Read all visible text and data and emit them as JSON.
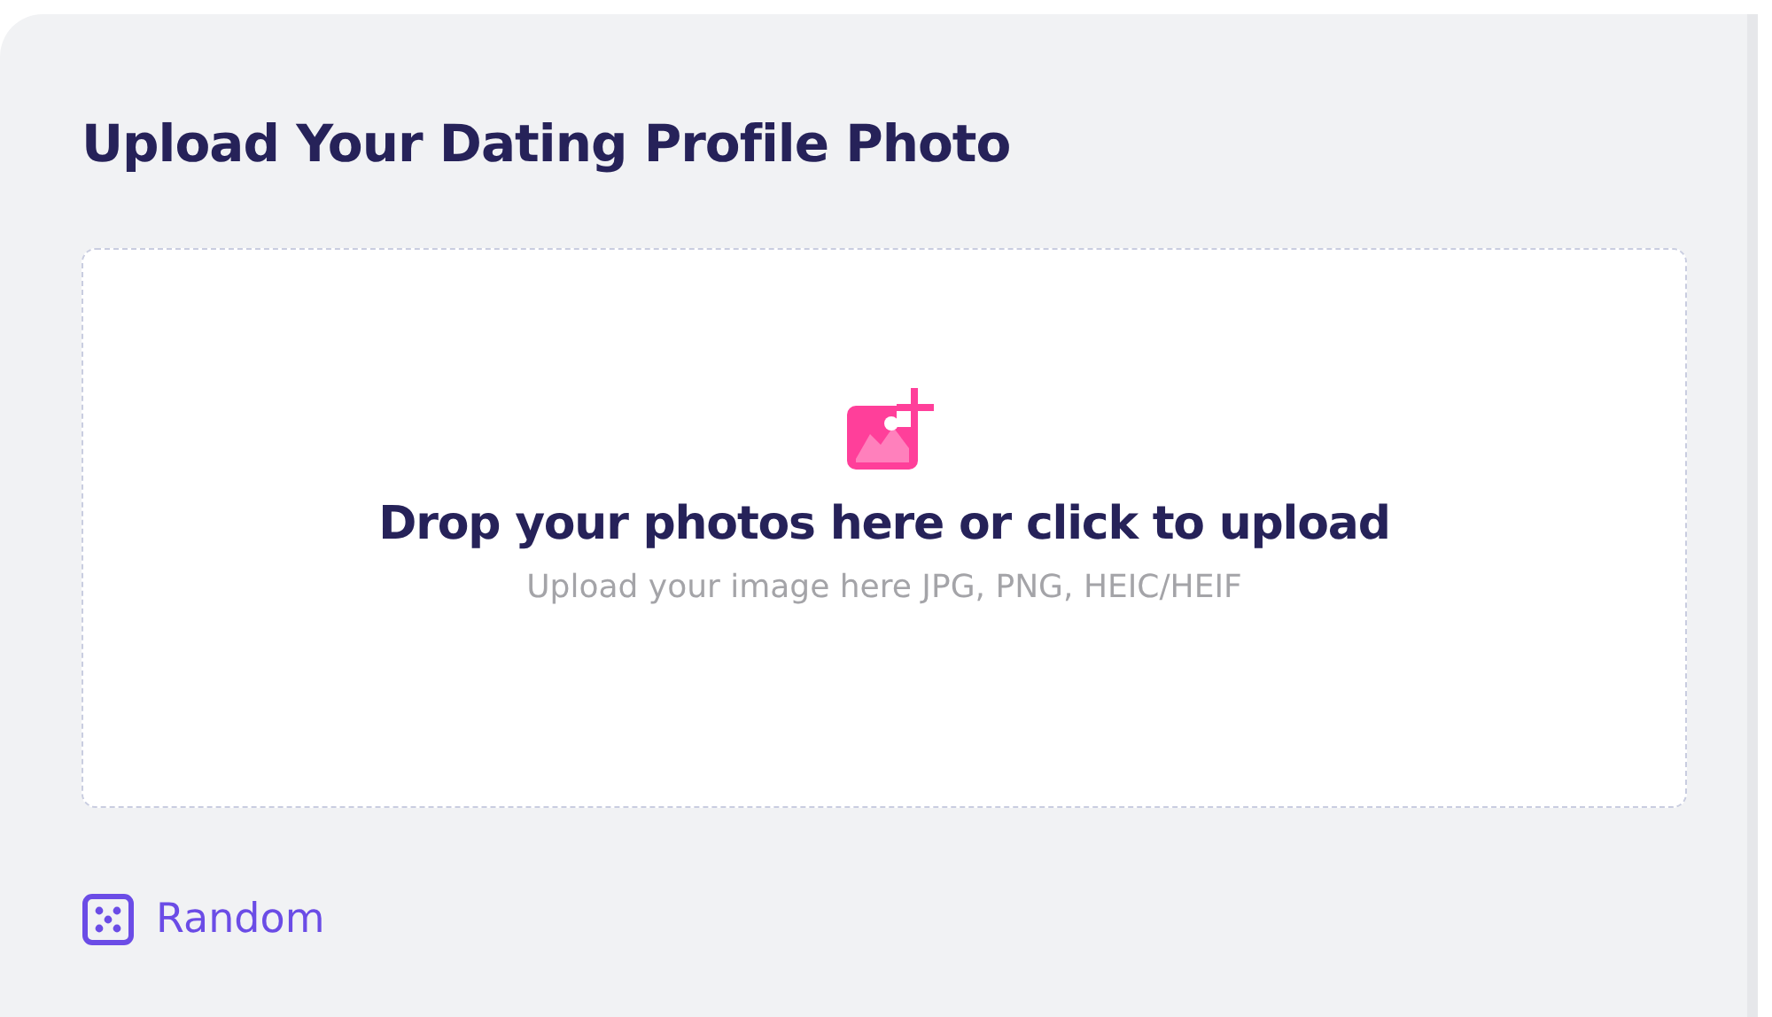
{
  "title": "Upload Your Dating Profile Photo",
  "dropzone": {
    "heading": "Drop your photos here or click to upload",
    "hint": "Upload your image here JPG, PNG, HEIC/HEIF"
  },
  "random_button": {
    "label": "Random"
  }
}
